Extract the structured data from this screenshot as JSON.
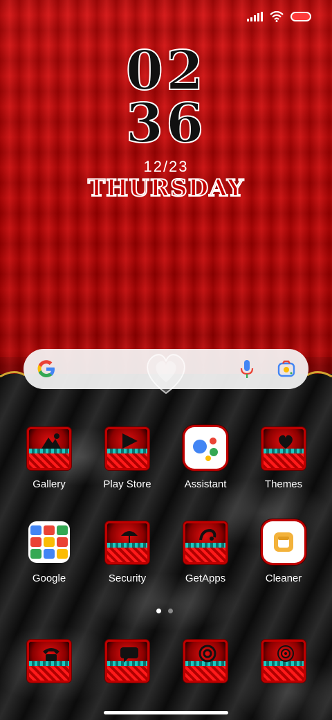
{
  "clock": {
    "hour": "02",
    "minute": "36"
  },
  "date": "12/23",
  "day": "THURSDAY",
  "search": {
    "mic_icon": "mic-icon",
    "lens_icon": "camera-lens-icon"
  },
  "apps_row1": [
    {
      "label": "Gallery",
      "icon": "gallery-icon"
    },
    {
      "label": "Play Store",
      "icon": "play-store-icon"
    },
    {
      "label": "Assistant",
      "icon": "assistant-icon"
    },
    {
      "label": "Themes",
      "icon": "themes-icon"
    }
  ],
  "apps_row2": [
    {
      "label": "Google",
      "icon": "google-folder-icon"
    },
    {
      "label": "Security",
      "icon": "security-icon"
    },
    {
      "label": "GetApps",
      "icon": "getapps-icon"
    },
    {
      "label": "Cleaner",
      "icon": "cleaner-icon"
    }
  ],
  "dock": [
    {
      "icon": "phone-icon"
    },
    {
      "icon": "messages-icon"
    },
    {
      "icon": "browser-icon"
    },
    {
      "icon": "camera-icon"
    }
  ],
  "page_indicator": {
    "pages": 2,
    "current": 1
  },
  "colors": {
    "accent": "#c00000",
    "lace": "#1ec8c0",
    "gold": "#d4a531"
  }
}
